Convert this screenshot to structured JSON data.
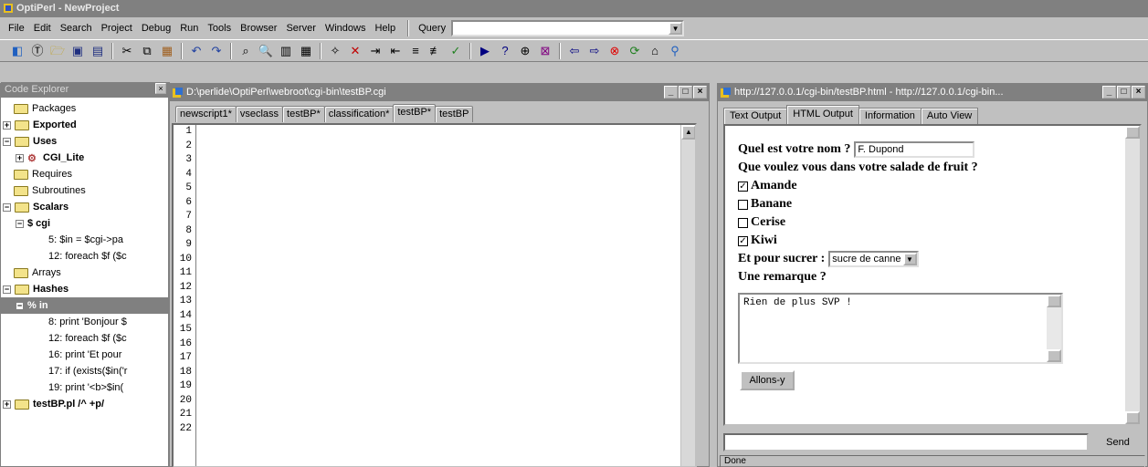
{
  "app": {
    "title": "OptiPerl - NewProject"
  },
  "menu": {
    "items": [
      "File",
      "Edit",
      "Search",
      "Project",
      "Debug",
      "Run",
      "Tools",
      "Browser",
      "Server",
      "Windows",
      "Help"
    ],
    "query_label": "Query",
    "query_value": ""
  },
  "explorer": {
    "title": "Code Explorer",
    "nodes": {
      "packages": "Packages",
      "exported": "Exported",
      "uses": "Uses",
      "cgi_lite": "CGI_Lite",
      "requires": "Requires",
      "subroutines": "Subroutines",
      "scalars": "Scalars",
      "cgi": "$ cgi",
      "ref1": "5: $in = $cgi->pa",
      "ref2": "12: foreach $f ($c",
      "arrays": "Arrays",
      "hashes": "Hashes",
      "in": "% in",
      "h1": "8: print 'Bonjour $",
      "h2": "12: foreach $f ($c",
      "h3": "16: print 'Et pour",
      "h4": "17: if (exists($in('r",
      "h5": "19: print '<b>$in(",
      "testbp": "testBP.pl /^ +p/"
    }
  },
  "editor": {
    "title": "D:\\perlide\\OptiPerl\\webroot\\cgi-bin\\testBP.cgi",
    "tabs": [
      "newscript1*",
      "vseclass",
      "testBP*",
      "classification*",
      "testBP*",
      "testBP"
    ],
    "line_numbers": [
      "1",
      "2",
      "3",
      "4",
      "5",
      "6",
      "7",
      "8",
      "9",
      "10",
      "11",
      "12",
      "13",
      "14",
      "15",
      "16",
      "17",
      "18",
      "19",
      "20",
      "21",
      "22"
    ]
  },
  "browser": {
    "title": "http://127.0.0.1/cgi-bin/testBP.html - http://127.0.0.1/cgi-bin...",
    "tabs": [
      "Text Output",
      "HTML Output",
      "Information",
      "Auto View"
    ],
    "q_name": "Quel est votre nom ?",
    "name_value": "F. Dupond",
    "q_fruit": "Que voulez vous dans votre salade de fruit ?",
    "fruits": [
      {
        "label": "Amande",
        "checked": true
      },
      {
        "label": "Banane",
        "checked": false
      },
      {
        "label": "Cerise",
        "checked": false
      },
      {
        "label": "Kiwi",
        "checked": true
      }
    ],
    "q_sucre": "Et pour sucrer :",
    "sucre_value": "sucre de canne",
    "q_remarque": "Une remarque ?",
    "remarque_value": "Rien de plus SVP !",
    "submit_label": "Allons-y",
    "send_label": "Send",
    "status": "Done"
  }
}
